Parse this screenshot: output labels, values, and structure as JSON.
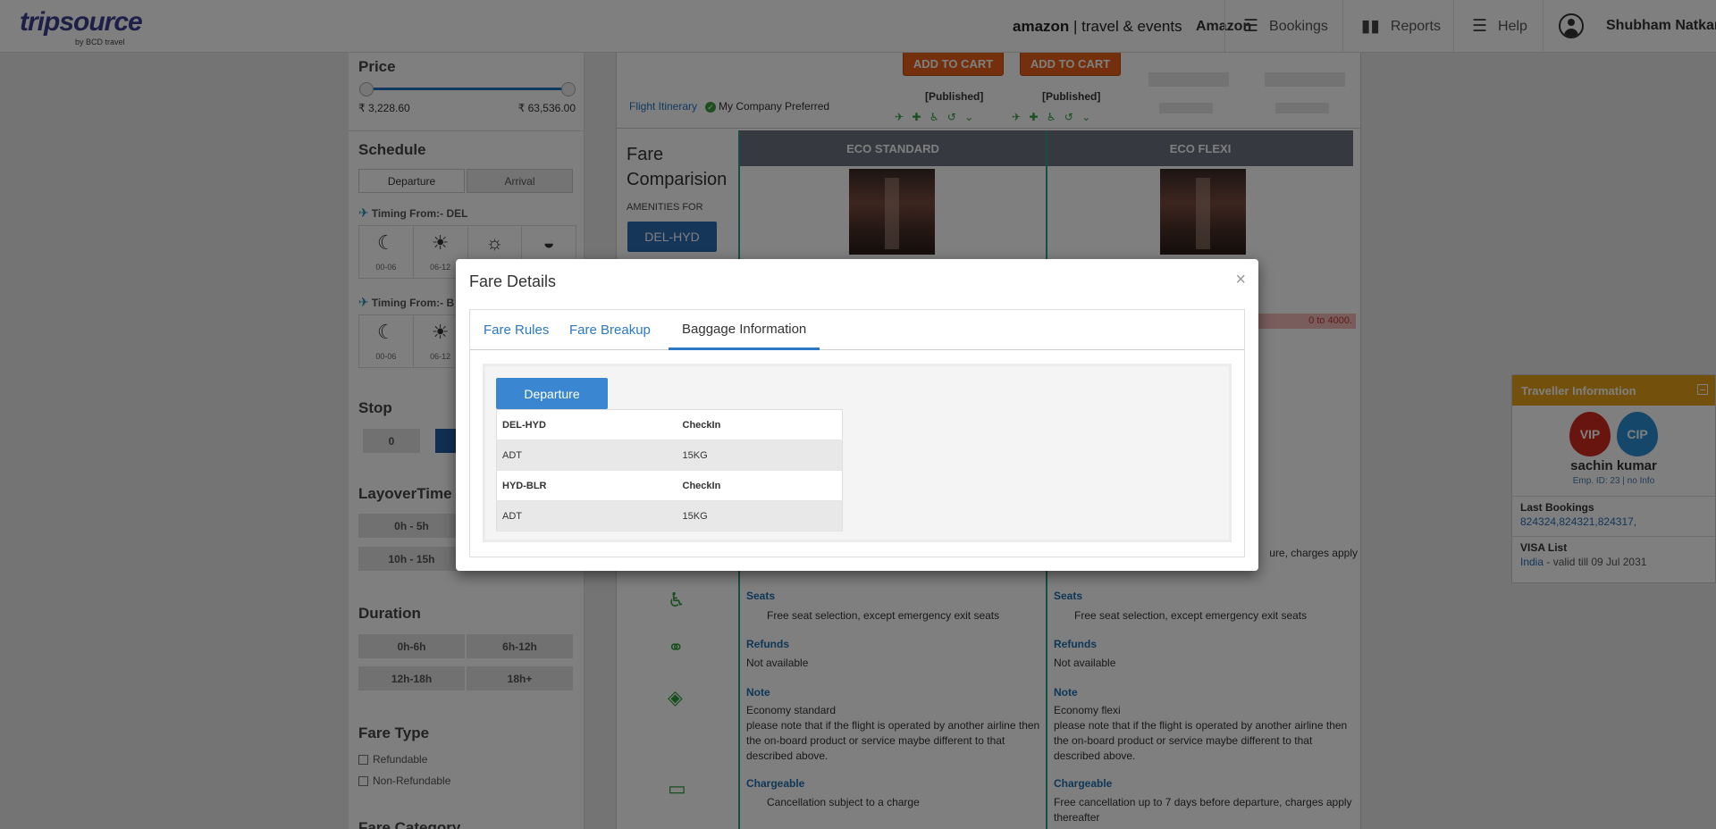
{
  "header": {
    "logo_text": "tripsource",
    "logo_sub": "by BCD travel",
    "brand_amazon": "amazon",
    "brand_rest": "| travel & events",
    "company": "Amazon",
    "nav": [
      {
        "label": "Bookings",
        "icon": "bookings-icon"
      },
      {
        "label": "Reports",
        "icon": "reports-icon"
      },
      {
        "label": "Help",
        "icon": "help-icon"
      }
    ],
    "user_name": "Shubham Natkar"
  },
  "sidebar": {
    "price_title": "Price",
    "price_min": "₹ 3,228.60",
    "price_max": "₹ 63,536.00",
    "schedule_title": "Schedule",
    "departure_tab": "Departure",
    "arrival_tab": "Arrival",
    "timing_from_1": "Timing From:- DEL",
    "timing_from_2": "Timing From:- B",
    "time_slots": [
      "00-06",
      "06-12",
      "",
      ""
    ],
    "stop_title": "Stop",
    "stop_0": "0",
    "layover_title": "LayoverTime",
    "layover_1": "0h - 5h",
    "layover_2": "10h - 15h",
    "duration_title": "Duration",
    "duration_options": [
      "0h-6h",
      "6h-12h",
      "12h-18h",
      "18h+"
    ],
    "fare_type_title": "Fare Type",
    "refundable": "Refundable",
    "non_refundable": "Non-Refundable",
    "fare_category_title": "Fare Category"
  },
  "main": {
    "add_to_cart": "ADD TO CART",
    "published": "[Published]",
    "flight_itinerary": "Flight Itinerary",
    "company_preferred": "My Company Preferred",
    "fare_comparison": "Fare Comparision",
    "amenities_for": "AMENITIES FOR",
    "route": "DEL-HYD",
    "col1_title": "ECO STANDARD",
    "col2_title": "ECO FLEXI",
    "notice_text": "0 to 4000.",
    "partial_text": "ure, charges apply",
    "seats_title": "Seats",
    "seats_text": "Free seat selection, except emergency exit seats",
    "refunds_title": "Refunds",
    "refunds_text": "Not available",
    "note_title": "Note",
    "note_col1_head": "Economy standard",
    "note_col2_head": "Economy flexi",
    "note_body": "please note that if the flight is operated by another airline then the on-board product or service maybe different to that described above.",
    "chargeable_title": "Chargeable",
    "chargeable_col1": "Cancellation subject to a charge",
    "chargeable_col2": "Free cancellation up to 7 days before departure, charges apply thereafter"
  },
  "traveller": {
    "title": "Traveller Information",
    "vip": "VIP",
    "cip": "CIP",
    "name": "sachin kumar",
    "emp": "Emp. ID: 23 | no Info",
    "last_bookings_title": "Last Bookings",
    "last_bookings": "824324,824321,824317,",
    "visa_title": "VISA List",
    "visa_country": "India",
    "visa_validity": " - valid till 09 Jul 2031"
  },
  "modal": {
    "title": "Fare Details",
    "close": "×",
    "tabs": [
      "Fare Rules",
      "Fare Breakup",
      "Baggage Information"
    ],
    "active_tab": "Baggage Information",
    "departure_btn": "Departure",
    "baggage": [
      {
        "sector": "DEL-HYD",
        "col": "CheckIn",
        "pax": "ADT",
        "allowance": "15KG"
      },
      {
        "sector": "HYD-BLR",
        "col": "CheckIn",
        "pax": "ADT",
        "allowance": "15KG"
      }
    ]
  }
}
